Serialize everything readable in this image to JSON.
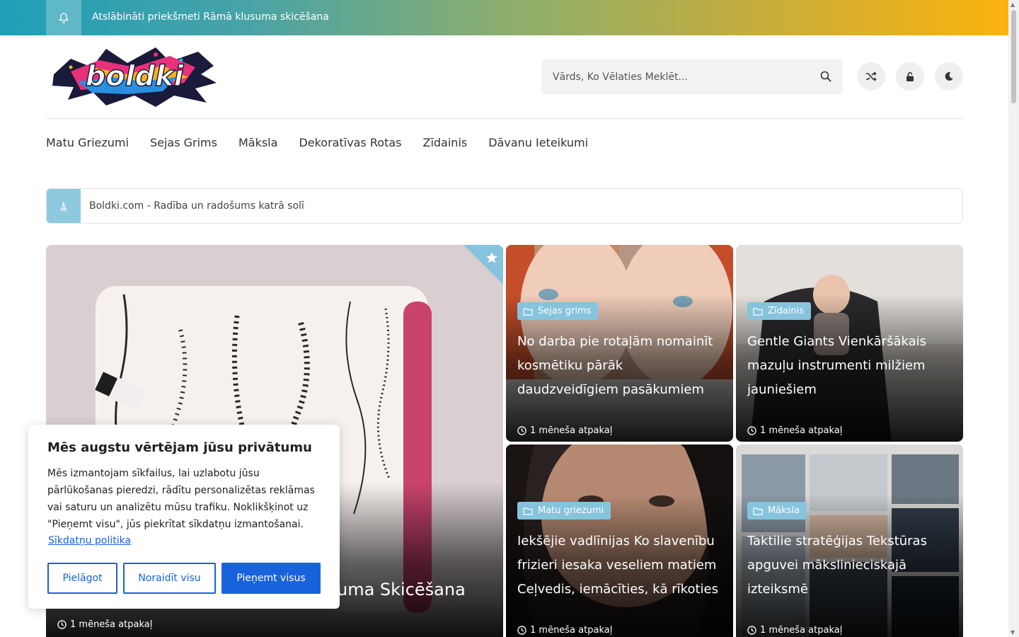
{
  "topbar": {
    "ticker": "Atslābināti priekšmeti Rāmā klusuma skicēšana",
    "gradient_start": "#1f9fb8",
    "gradient_end": "#fcb20e"
  },
  "logo": {
    "text": "boldki"
  },
  "search": {
    "placeholder": "Vārds, Ko Vēlaties Meklēt..."
  },
  "nav": {
    "items": [
      {
        "label": "Matu Griezumi"
      },
      {
        "label": "Sejas Grims"
      },
      {
        "label": "Māksla"
      },
      {
        "label": "Dekoratīvas Rotas"
      },
      {
        "label": "Zīdainis"
      },
      {
        "label": "Dāvanu Ieteikumi"
      }
    ]
  },
  "tagline": {
    "text": "Boldki.com - Radība un radošums katrā solī"
  },
  "featured": {
    "title": "Atslābināti priekšmeti Rāmā klusuma Skicēšana",
    "time": "1 mēneša atpakaļ"
  },
  "cards": [
    {
      "category": "Sejas grims",
      "title": "No darba pie rotaļām nomainīt kosmētiku pārāk daudzveidīgiem pasākumiem",
      "time": "1 mēneša atpakaļ"
    },
    {
      "category": "Zīdainis",
      "title": "Gentle Giants Vienkāršākais mazuļu instrumenti milžiem jauniešiem",
      "time": "1 mēneša atpakaļ"
    },
    {
      "category": "Matu griezumi",
      "title": "Iekšējie vadlīnijas Ko slavenību frizieri iesaka veseliem matiem Ceļvedis, iemācīties, kā rīkoties",
      "time": "1 mēneša atpakaļ"
    },
    {
      "category": "Māksla",
      "title": "Taktilie stratēģijas Tekstūras apguvei mākslinieciskajā izteiksmē",
      "time": "1 mēneša atpakaļ"
    }
  ],
  "consent": {
    "title": "Mēs augstu vērtējam jūsu privātumu",
    "body": "Mēs izmantojam sīkfailus, lai uzlabotu jūsu pārlūkošanas pieredzi, rādītu personalizētas reklāmas vai saturu un analizētu mūsu trafiku. Noklikšķinot uz \"Pieņemt visu\", jūs piekrītat sīkdatņu izmantošanai.",
    "policy_link": "Sīkdatņu politika",
    "customize": "Pielāgot",
    "reject": "Noraidīt visu",
    "accept": "Pieņemt visus",
    "accent": "#1863dc"
  }
}
